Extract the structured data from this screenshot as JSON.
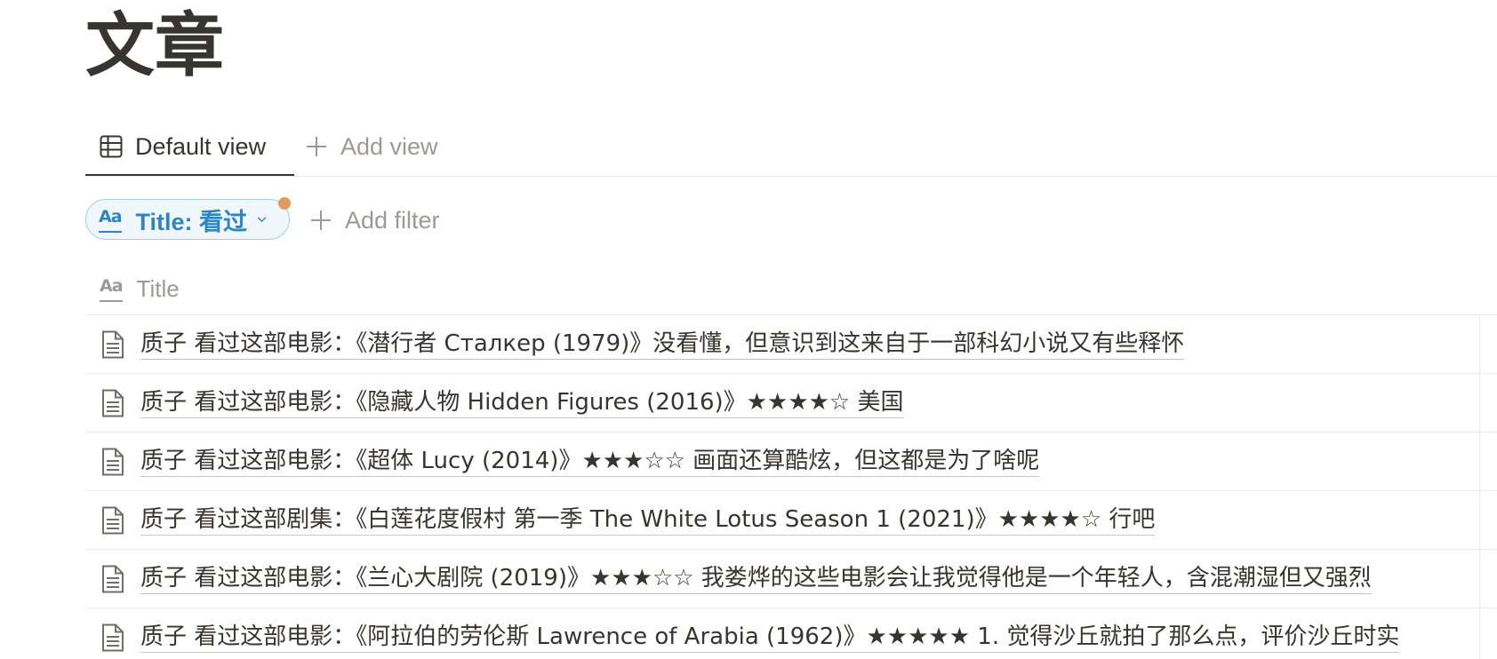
{
  "page": {
    "title": "文章"
  },
  "views": {
    "active_label": "Default view",
    "active_icon": "table-icon",
    "add_label": "Add view"
  },
  "filter": {
    "pill_label": "Title: 看过",
    "pill_icon": "text-property-icon",
    "add_label": "Add filter",
    "indicator_color": "#e39a5e",
    "accent_color": "#2f84c4"
  },
  "table": {
    "column_header": "Title",
    "rows": [
      {
        "title": "质子 看过这部电影：《潜行者 Сталкер (1979)》没看懂，但意识到这来自于一部科幻小说又有些释怀"
      },
      {
        "title": "质子 看过这部电影：《隐藏人物 Hidden Figures (2016)》★★★★☆ 美国"
      },
      {
        "title": "质子 看过这部电影：《超体 Lucy (2014)》★★★☆☆ 画面还算酷炫，但这都是为了啥呢"
      },
      {
        "title": "质子 看过这部剧集：《白莲花度假村 第一季 The White Lotus Season 1 (2021)》★★★★☆ 行吧"
      },
      {
        "title": "质子 看过这部电影：《兰心大剧院 (2019)》★★★☆☆ 我娄烨的这些电影会让我觉得他是一个年轻人，含混潮湿但又强烈"
      },
      {
        "title": "质子 看过这部电影：《阿拉伯的劳伦斯 Lawrence of Arabia (1962)》★★★★★ 1. 觉得沙丘就拍了那么点，评价沙丘时实"
      }
    ]
  }
}
